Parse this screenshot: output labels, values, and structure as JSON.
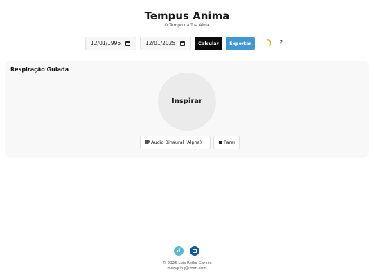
{
  "header": {
    "title": "Tempus Anima",
    "subtitle": "O Tempo da Tua Alma"
  },
  "toolbar": {
    "start_date": "12/01/1995",
    "end_date": "12/01/2025",
    "calculate_label": "Calcular",
    "export_label": "Exportar",
    "theme_icon": "moon-icon",
    "help_label": "?"
  },
  "breathing": {
    "title": "Respiração Guiada",
    "phase": "Inspirar",
    "audio_label": "Áudio Binaural (Alpha)",
    "stop_label": "Parar"
  },
  "footer": {
    "social_d_label": "d",
    "copyright": "© 2025 Luís Reiko Garcês",
    "email": "moruping@msn.com"
  },
  "colors": {
    "calculate_bg": "#0c0c0c",
    "export_bg": "#3f97d3",
    "card_bg": "#f8f8f8",
    "circle_bg": "#ebebeb",
    "social_d_bg": "#58b9d1",
    "social_linkedin_bg": "#0e5a9c"
  }
}
